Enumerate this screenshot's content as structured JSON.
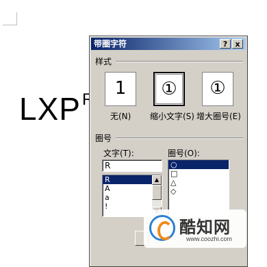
{
  "document": {
    "text": "LXP",
    "superscript": "R"
  },
  "dialog": {
    "title": "带圈字符",
    "help_button": "?",
    "close_button": "x",
    "style_group": {
      "label": "样式",
      "options": [
        {
          "glyph": "1",
          "caption": "无(N)"
        },
        {
          "glyph": "①",
          "caption": "缩小文字(S)"
        },
        {
          "glyph": "①",
          "caption": "增大圈号(E)"
        }
      ],
      "selected_index": 1
    },
    "circle_group": {
      "label": "圈号",
      "text_label": "文字(T):",
      "text_value": "R",
      "text_list": [
        "R",
        "A",
        "a",
        "!"
      ],
      "text_list_selected": "R",
      "circle_label": "圈号(O):",
      "circle_list": [
        "○",
        "□",
        "△",
        "◇"
      ],
      "circle_list_selected": "○"
    }
  },
  "watermark": {
    "title": "酷知网",
    "url": "www.coozhi.com"
  },
  "colors": {
    "titlebar": "#0a246a",
    "dialog_bg": "#d4d0c8",
    "selection": "#0a246a"
  }
}
